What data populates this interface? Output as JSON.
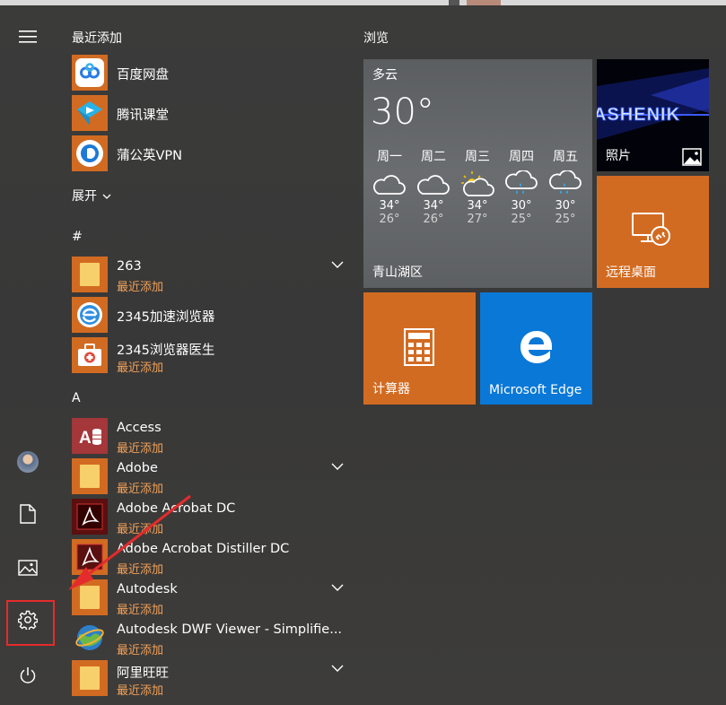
{
  "recent_header": "最近添加",
  "recent_apps": [
    {
      "name": "百度网盘",
      "icon": "baidu-netdisk-icon"
    },
    {
      "name": "腾讯课堂",
      "icon": "tencent-classroom-icon"
    },
    {
      "name": "蒲公英VPN",
      "icon": "pgy-vpn-icon"
    }
  ],
  "expand_label": "展开",
  "sections": {
    "hash": "#",
    "a": "A"
  },
  "apps": [
    {
      "name": "263",
      "sub": "最近添加",
      "icon": "folder-icon",
      "expandable": true
    },
    {
      "name": "2345加速浏览器",
      "sub": "",
      "icon": "browser-icon",
      "expandable": false
    },
    {
      "name": "2345浏览器医生",
      "sub": "最近添加",
      "icon": "medical-kit-icon",
      "expandable": false
    },
    {
      "name": "Access",
      "sub": "最近添加",
      "icon": "access-icon",
      "expandable": false
    },
    {
      "name": "Adobe",
      "sub": "最近添加",
      "icon": "folder-icon",
      "expandable": true
    },
    {
      "name": "Adobe Acrobat DC",
      "sub": "最近添加",
      "icon": "acrobat-icon",
      "expandable": false
    },
    {
      "name": "Adobe Acrobat Distiller DC",
      "sub": "最近添加",
      "icon": "acrobat-distiller-icon",
      "expandable": false
    },
    {
      "name": "Autodesk",
      "sub": "最近添加",
      "icon": "folder-icon",
      "expandable": true
    },
    {
      "name": "Autodesk DWF Viewer - Simplifie...",
      "sub": "最近添加",
      "icon": "globe-icon",
      "expandable": false
    },
    {
      "name": "阿里旺旺",
      "sub": "最近添加",
      "icon": "folder-icon",
      "expandable": true
    }
  ],
  "browse_header": "浏览",
  "weather": {
    "condition": "多云",
    "temp": "30°",
    "location": "青山湖区",
    "days": [
      {
        "day": "周一",
        "icon": "cloud-icon",
        "hi": "34°",
        "lo": "26°"
      },
      {
        "day": "周二",
        "icon": "cloud-icon",
        "hi": "34°",
        "lo": "26°"
      },
      {
        "day": "周三",
        "icon": "partly-sunny-icon",
        "hi": "34°",
        "lo": "27°"
      },
      {
        "day": "周四",
        "icon": "rain-icon",
        "hi": "30°",
        "lo": "25°"
      },
      {
        "day": "周五",
        "icon": "rain-icon",
        "hi": "30°",
        "lo": "25°"
      }
    ]
  },
  "tiles": {
    "photos": "照片",
    "photos_art": "ASHENIK",
    "remote": "远程桌面",
    "calc": "计算器",
    "edge": "Microsoft Edge"
  },
  "colors": {
    "accent": "#d26b22",
    "edge": "#0a78d7",
    "recent_text": "#f4a259",
    "highlight": "#e52b2b"
  }
}
